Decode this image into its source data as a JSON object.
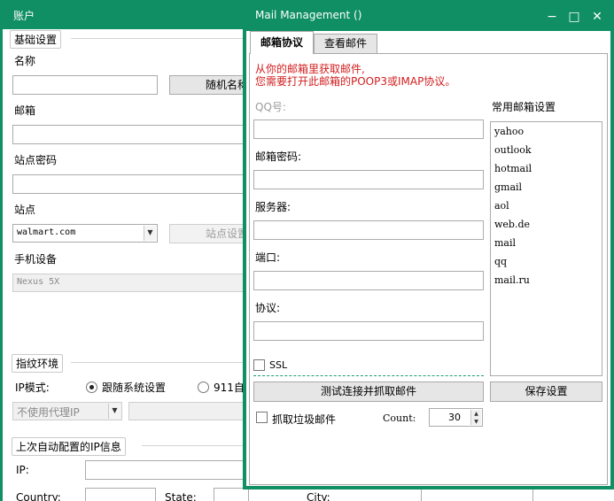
{
  "account_window": {
    "title": "账户",
    "basic_settings": {
      "caption": "基础设置",
      "name_label": "名称",
      "random_name_button": "随机名称",
      "email_label": "邮箱",
      "site_password_label": "站点密码",
      "site_label": "站点",
      "site_value": "walmart.com",
      "site_settings_button": "站点设置",
      "device_label": "手机设备",
      "device_value": "Nexus 5X"
    },
    "fingerprint_env": {
      "caption": "指纹环境",
      "ip_mode_label": "IP模式:",
      "ip_mode_follow_system": "跟随系统设置",
      "ip_mode_911": "911自",
      "proxy_value": "不使用代理IP"
    },
    "last_auto_ip": {
      "caption": "上次自动配置的IP信息",
      "ip_label": "IP:",
      "country_label": "Country:",
      "state_label": "State:",
      "city_label": "City:"
    }
  },
  "mail_dialog": {
    "title": "Mail Management ()",
    "controls": {
      "minimize": "−",
      "maximize": "□",
      "close": "✕"
    },
    "tabs": [
      {
        "label": "邮箱协议",
        "active": true
      },
      {
        "label": "查看邮件",
        "active": false
      }
    ],
    "note_line1": "从你的邮箱里获取邮件,",
    "note_line2": "您需要打开此邮箱的POOP3或IMAP协议。",
    "qq_label": "QQ号:",
    "password_label": "邮箱密码:",
    "server_label": "服务器:",
    "port_label": "端口:",
    "protocol_label": "协议:",
    "ssl_label": "SSL",
    "common_settings_label": "常用邮箱设置",
    "common_providers": [
      "yahoo",
      "outlook",
      "hotmail",
      "gmail",
      "aol",
      "web.de",
      "mail",
      "qq",
      "mail.ru"
    ],
    "test_button": "测试连接并抓取邮件",
    "save_button": "保存设置",
    "junk_label": "抓取垃圾邮件",
    "count_label": "Count:",
    "count_value": "30",
    "accent_color": "#0f8f63",
    "note_color": "#d21d1d"
  }
}
